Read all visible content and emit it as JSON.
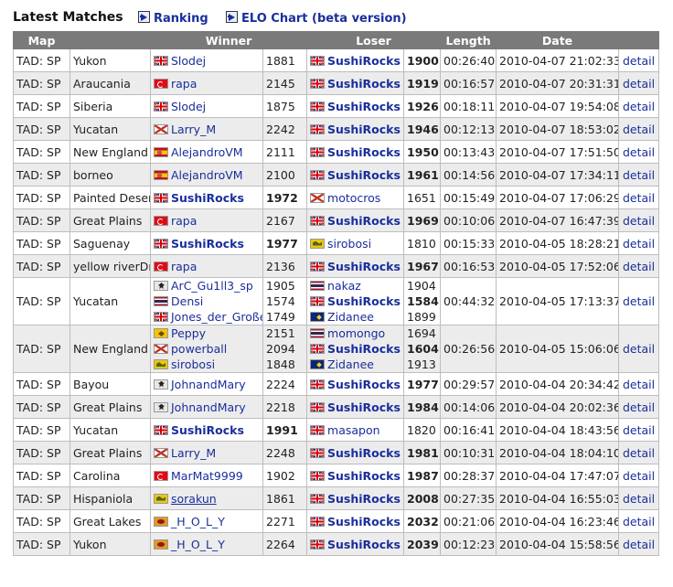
{
  "header": {
    "title": "Latest Matches",
    "ranking_label": "Ranking",
    "elo_chart_label": "ELO Chart (beta version)"
  },
  "columns": [
    "Map",
    "Winner",
    "Loser",
    "Length",
    "Date"
  ],
  "detail_label": "detail",
  "matches": [
    {
      "type": "TAD: SP",
      "map": "Yukon",
      "winner": {
        "name": "Slodej",
        "flag": "uk",
        "elo": "1881",
        "bold": false
      },
      "loser": {
        "name": "SushiRocks",
        "flag": "uk",
        "elo": "1900",
        "bold": true
      },
      "length": "00:26:40",
      "date": "2010-04-07 21:02:33"
    },
    {
      "type": "TAD: SP",
      "map": "Araucania",
      "winner": {
        "name": "rapa",
        "flag": "tr",
        "elo": "2145",
        "bold": false
      },
      "loser": {
        "name": "SushiRocks",
        "flag": "uk",
        "elo": "1919",
        "bold": true
      },
      "length": "00:16:57",
      "date": "2010-04-07 20:31:31"
    },
    {
      "type": "TAD: SP",
      "map": "Siberia",
      "winner": {
        "name": "Slodej",
        "flag": "uk",
        "elo": "1875",
        "bold": false
      },
      "loser": {
        "name": "SushiRocks",
        "flag": "uk",
        "elo": "1926",
        "bold": true
      },
      "length": "00:18:11",
      "date": "2010-04-07 19:54:08"
    },
    {
      "type": "TAD: SP",
      "map": "Yucatan",
      "winner": {
        "name": "Larry_M",
        "flag": "x",
        "elo": "2242",
        "bold": false
      },
      "loser": {
        "name": "SushiRocks",
        "flag": "uk",
        "elo": "1946",
        "bold": true
      },
      "length": "00:12:13",
      "date": "2010-04-07 18:53:02"
    },
    {
      "type": "TAD: SP",
      "map": "New England",
      "winner": {
        "name": "AlejandroVM",
        "flag": "es",
        "elo": "2111",
        "bold": false
      },
      "loser": {
        "name": "SushiRocks",
        "flag": "uk",
        "elo": "1950",
        "bold": true
      },
      "length": "00:13:43",
      "date": "2010-04-07 17:51:50"
    },
    {
      "type": "TAD: SP",
      "map": "borneo",
      "winner": {
        "name": "AlejandroVM",
        "flag": "es",
        "elo": "2100",
        "bold": false
      },
      "loser": {
        "name": "SushiRocks",
        "flag": "uk",
        "elo": "1961",
        "bold": true
      },
      "length": "00:14:56",
      "date": "2010-04-07 17:34:11"
    },
    {
      "type": "TAD: SP",
      "map": "Painted Desert",
      "winner": {
        "name": "SushiRocks",
        "flag": "uk",
        "elo": "1972",
        "bold": true
      },
      "loser": {
        "name": "motocros",
        "flag": "x",
        "elo": "1651",
        "bold": false
      },
      "length": "00:15:49",
      "date": "2010-04-07 17:06:29"
    },
    {
      "type": "TAD: SP",
      "map": "Great Plains",
      "winner": {
        "name": "rapa",
        "flag": "tr",
        "elo": "2167",
        "bold": false
      },
      "loser": {
        "name": "SushiRocks",
        "flag": "uk",
        "elo": "1969",
        "bold": true
      },
      "length": "00:10:06",
      "date": "2010-04-07 16:47:39"
    },
    {
      "type": "TAD: SP",
      "map": "Saguenay",
      "winner": {
        "name": "SushiRocks",
        "flag": "uk",
        "elo": "1977",
        "bold": true
      },
      "loser": {
        "name": "sirobosi",
        "flag": "br",
        "elo": "1810",
        "bold": false
      },
      "length": "00:15:33",
      "date": "2010-04-05 18:28:21"
    },
    {
      "type": "TAD: SP",
      "map": "yellow riverDry",
      "winner": {
        "name": "rapa",
        "flag": "tr",
        "elo": "2136",
        "bold": false
      },
      "loser": {
        "name": "SushiRocks",
        "flag": "uk",
        "elo": "1967",
        "bold": true
      },
      "length": "00:16:53",
      "date": "2010-04-05 17:52:06"
    }
  ],
  "team_matches": [
    {
      "type": "TAD: SP",
      "map": "Yucatan",
      "winners": [
        {
          "name": "ArC_Gu1ll3_sp",
          "flag": "de",
          "elo": "1905",
          "bold": false
        },
        {
          "name": "Densi",
          "flag": "th",
          "elo": "1574",
          "bold": false
        },
        {
          "name": "Jones_der_Große",
          "flag": "uk",
          "elo": "1749",
          "bold": false
        }
      ],
      "losers": [
        {
          "name": "nakaz",
          "flag": "th",
          "elo": "1904",
          "bold": false
        },
        {
          "name": "SushiRocks",
          "flag": "uk",
          "elo": "1584",
          "bold": true
        },
        {
          "name": "Zidanee",
          "flag": "au",
          "elo": "1899",
          "bold": false
        }
      ],
      "length": "00:44:32",
      "date": "2010-04-05 17:13:37"
    },
    {
      "type": "TAD: SP",
      "map": "New England",
      "winners": [
        {
          "name": "Peppy",
          "flag": "pe",
          "elo": "2151",
          "bold": false
        },
        {
          "name": "powerball",
          "flag": "x",
          "elo": "2094",
          "bold": false
        },
        {
          "name": "sirobosi",
          "flag": "br",
          "elo": "1848",
          "bold": false
        }
      ],
      "losers": [
        {
          "name": "momongo",
          "flag": "th",
          "elo": "1694",
          "bold": false
        },
        {
          "name": "SushiRocks",
          "flag": "uk",
          "elo": "1604",
          "bold": true
        },
        {
          "name": "Zidanee",
          "flag": "au",
          "elo": "1913",
          "bold": false
        }
      ],
      "length": "00:26:56",
      "date": "2010-04-05 15:06:06"
    }
  ],
  "matches2": [
    {
      "type": "TAD: SP",
      "map": "Bayou",
      "winner": {
        "name": "JohnandMary",
        "flag": "de",
        "elo": "2224",
        "bold": false
      },
      "loser": {
        "name": "SushiRocks",
        "flag": "uk",
        "elo": "1977",
        "bold": true
      },
      "length": "00:29:57",
      "date": "2010-04-04 20:34:42"
    },
    {
      "type": "TAD: SP",
      "map": "Great Plains",
      "winner": {
        "name": "JohnandMary",
        "flag": "de",
        "elo": "2218",
        "bold": false
      },
      "loser": {
        "name": "SushiRocks",
        "flag": "uk",
        "elo": "1984",
        "bold": true
      },
      "length": "00:14:06",
      "date": "2010-04-04 20:02:36"
    },
    {
      "type": "TAD: SP",
      "map": "Yucatan",
      "winner": {
        "name": "SushiRocks",
        "flag": "uk",
        "elo": "1991",
        "bold": true
      },
      "loser": {
        "name": "masapon",
        "flag": "uk",
        "elo": "1820",
        "bold": false
      },
      "length": "00:16:41",
      "date": "2010-04-04 18:43:56"
    },
    {
      "type": "TAD: SP",
      "map": "Great Plains",
      "winner": {
        "name": "Larry_M",
        "flag": "x",
        "elo": "2248",
        "bold": false
      },
      "loser": {
        "name": "SushiRocks",
        "flag": "uk",
        "elo": "1981",
        "bold": true
      },
      "length": "00:10:31",
      "date": "2010-04-04 18:04:10"
    },
    {
      "type": "TAD: SP",
      "map": "Carolina",
      "winner": {
        "name": "MarMat9999",
        "flag": "tr",
        "elo": "1902",
        "bold": false
      },
      "loser": {
        "name": "SushiRocks",
        "flag": "uk",
        "elo": "1987",
        "bold": true
      },
      "length": "00:28:37",
      "date": "2010-04-04 17:47:07"
    },
    {
      "type": "TAD: SP",
      "map": "Hispaniola",
      "winner": {
        "name": "sorakun",
        "flag": "br",
        "elo": "1861",
        "bold": false,
        "underline": true
      },
      "loser": {
        "name": "SushiRocks",
        "flag": "uk",
        "elo": "2008",
        "bold": true
      },
      "length": "00:27:35",
      "date": "2010-04-04 16:55:03"
    },
    {
      "type": "TAD: SP",
      "map": "Great Lakes",
      "winner": {
        "name": "_H_O_L_Y",
        "flag": "ex",
        "elo": "2271",
        "bold": false
      },
      "loser": {
        "name": "SushiRocks",
        "flag": "uk",
        "elo": "2032",
        "bold": true
      },
      "length": "00:21:06",
      "date": "2010-04-04 16:23:46"
    },
    {
      "type": "TAD: SP",
      "map": "Yukon",
      "winner": {
        "name": "_H_O_L_Y",
        "flag": "ex",
        "elo": "2264",
        "bold": false
      },
      "loser": {
        "name": "SushiRocks",
        "flag": "uk",
        "elo": "2039",
        "bold": true
      },
      "length": "00:12:23",
      "date": "2010-04-04 15:58:56"
    }
  ]
}
